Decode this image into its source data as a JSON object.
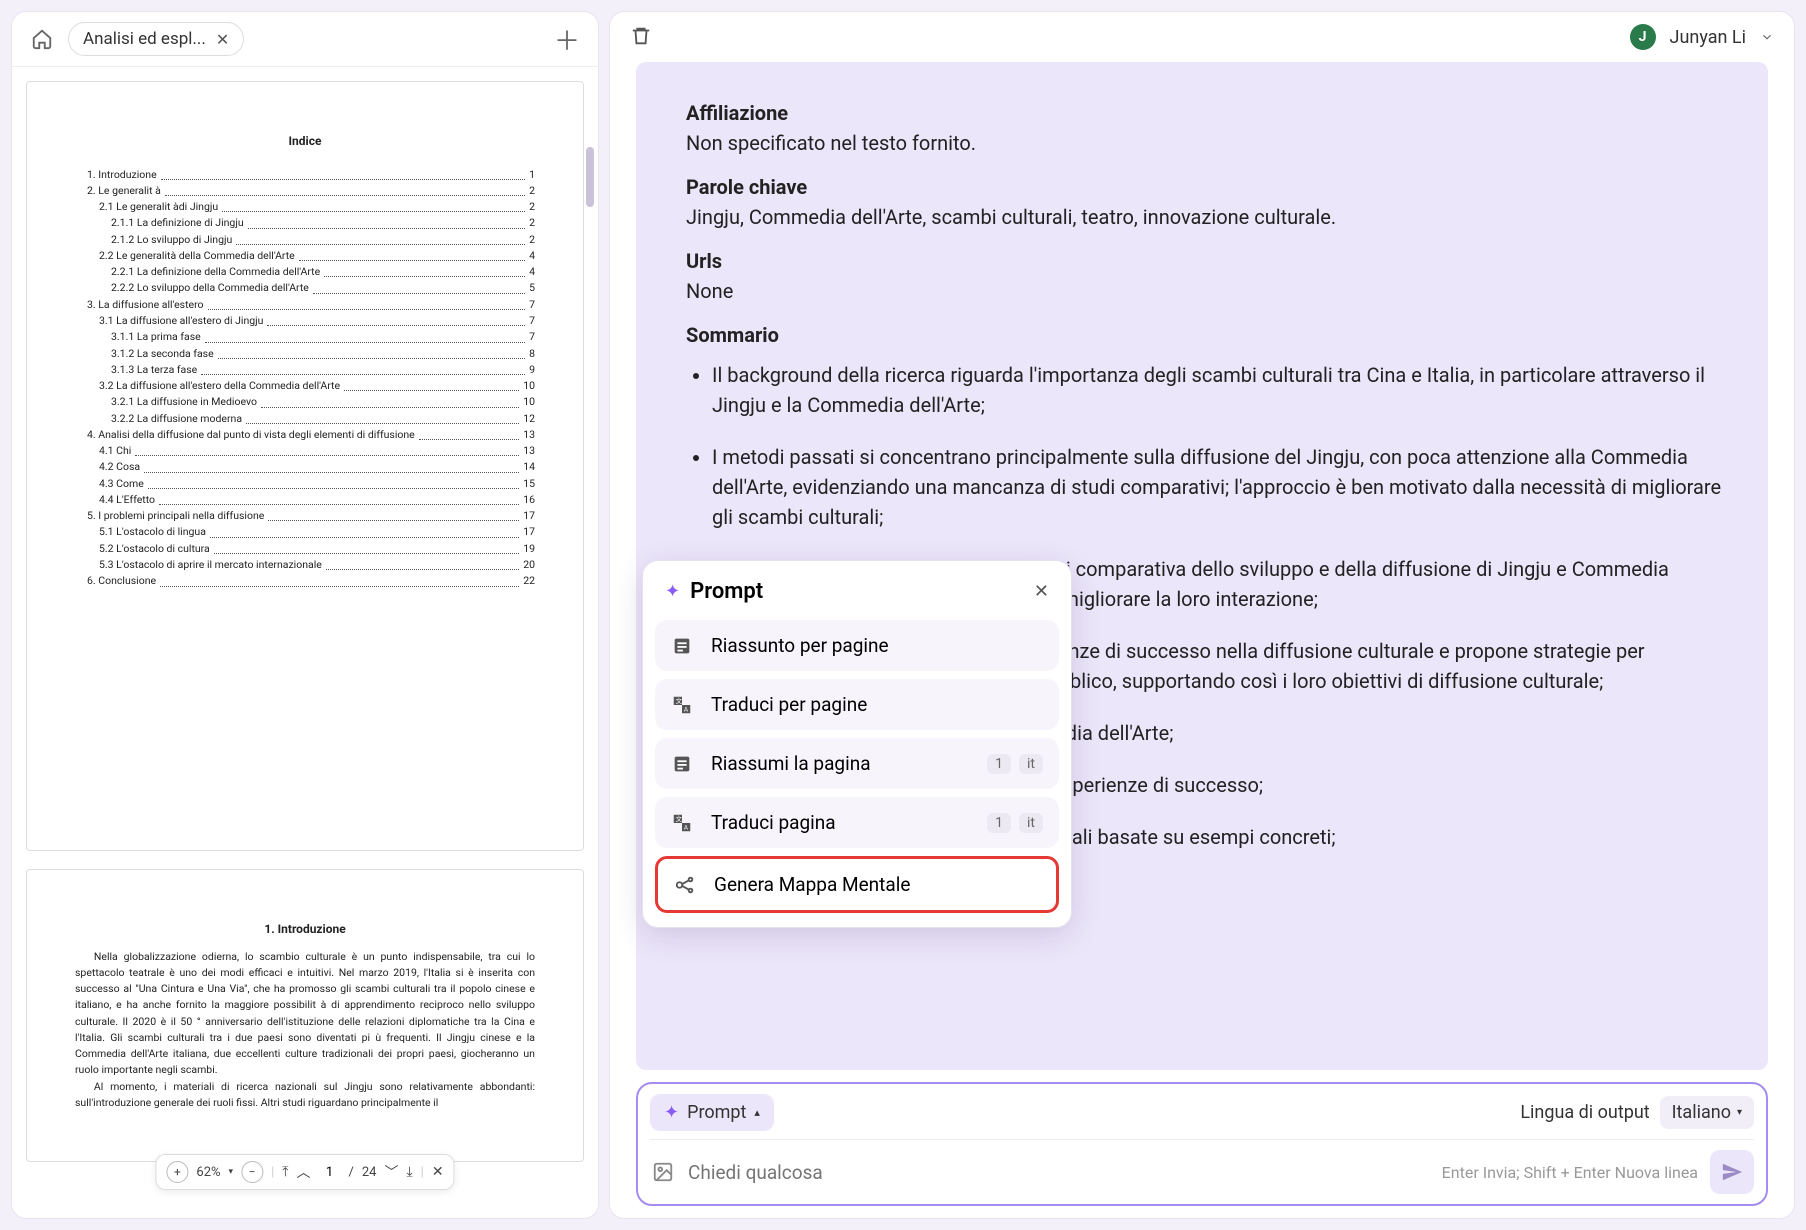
{
  "tab": {
    "label": "Analisi ed espl..."
  },
  "user": {
    "initial": "J",
    "name": "Junyan Li"
  },
  "doc": {
    "index_title": "Indice",
    "toc": [
      {
        "level": 1,
        "label": "1. Introduzione",
        "page": "1"
      },
      {
        "level": 1,
        "label": "2. Le generalit à",
        "page": "2"
      },
      {
        "level": 2,
        "label": "2.1 Le generalit àdi Jingju",
        "page": "2"
      },
      {
        "level": 3,
        "label": "2.1.1 La definizione di Jingju",
        "page": "2"
      },
      {
        "level": 3,
        "label": "2.1.2 Lo sviluppo di Jingju",
        "page": "2"
      },
      {
        "level": 2,
        "label": "2.2 Le generalità della Commedia dell'Arte",
        "page": "4"
      },
      {
        "level": 3,
        "label": "2.2.1 La definizione della Commedia dell'Arte",
        "page": "4"
      },
      {
        "level": 3,
        "label": "2.2.2 Lo sviluppo della Commedia dell'Arte",
        "page": "5"
      },
      {
        "level": 1,
        "label": "3. La diffusione all'estero",
        "page": "7"
      },
      {
        "level": 2,
        "label": "3.1 La diffusione all'estero di Jingju",
        "page": "7"
      },
      {
        "level": 3,
        "label": "3.1.1 La prima fase",
        "page": "7"
      },
      {
        "level": 3,
        "label": "3.1.2 La seconda fase",
        "page": "8"
      },
      {
        "level": 3,
        "label": "3.1.3 La terza fase",
        "page": "9"
      },
      {
        "level": 2,
        "label": "3.2 La diffusione all'estero della Commedia dell'Arte",
        "page": "10"
      },
      {
        "level": 3,
        "label": "3.2.1 La diffusione in Medioevo",
        "page": "10"
      },
      {
        "level": 3,
        "label": "3.2.2 La diffusione moderna",
        "page": "12"
      },
      {
        "level": 1,
        "label": "4. Analisi della diffusione dal punto di vista degli elementi di diffusione",
        "page": "13"
      },
      {
        "level": 2,
        "label": "4.1 Chi",
        "page": "13"
      },
      {
        "level": 2,
        "label": "4.2 Cosa",
        "page": "14"
      },
      {
        "level": 2,
        "label": "4.3 Come",
        "page": "15"
      },
      {
        "level": 2,
        "label": "4.4 L'Effetto",
        "page": "16"
      },
      {
        "level": 1,
        "label": "5. I problemi principali nella diffusione",
        "page": "17"
      },
      {
        "level": 2,
        "label": "5.1 L'ostacolo di lingua",
        "page": "17"
      },
      {
        "level": 2,
        "label": "5.2 L'ostacolo di cultura",
        "page": "19"
      },
      {
        "level": 2,
        "label": "5.3 L'ostacolo di aprire il mercato internazionale",
        "page": "20"
      },
      {
        "level": 1,
        "label": "6. Conclusione",
        "page": "22"
      }
    ],
    "intro_heading": "1. Introduzione",
    "intro_body": "Nella globalizzazione odierna, lo scambio culturale è un punto indispensabile, tra cui lo spettacolo teatrale è uno dei modi efficaci e intuitivi. Nel marzo 2019, l'Italia si è inserita con successo al \"Una Cintura e Una Via\", che ha promosso gli scambi culturali tra il popolo cinese e italiano, e ha anche fornito la maggiore possibilit à di apprendimento reciproco nello sviluppo culturale. Il 2020 è il 50 ° anniversario dell'istituzione delle relazioni diplomatiche tra la Cina e l'Italia. Gli scambi culturali tra i due paesi sono diventati pi ù frequenti. Il Jingju cinese e la Commedia dell'Arte italiana, due eccellenti culture tradizionali dei propri paesi, giocheranno un ruolo importante negli scambi.",
    "intro_body2": "Al momento, i materiali di ricerca nazionali sul Jingju sono relativamente abbondanti: sull'introduzione generale dei ruoli fissi. Altri studi riguardano principalmente il"
  },
  "pdf_toolbar": {
    "zoom": "62%",
    "page": "1",
    "total": "24"
  },
  "result": {
    "sections": [
      {
        "title": "Affiliazione",
        "value": "Non specificato nel testo fornito."
      },
      {
        "title": "Parole chiave",
        "value": "Jingju, Commedia dell'Arte, scambi culturali, teatro, innovazione culturale."
      },
      {
        "title": "Urls",
        "value": "None"
      }
    ],
    "summary_title": "Sommario",
    "bullets": [
      "Il background della ricerca riguarda l'importanza degli scambi culturali tra Cina e Italia, in particolare attraverso il Jingju e la Commedia dell'Arte;",
      "I metodi passati si concentrano principalmente sulla diffusione del Jingju, con poca attenzione alla Commedia dell'Arte, evidenziando una mancanza di studi comparativi; l'approccio è ben motivato dalla necessità di migliorare gli scambi culturali;",
      "Il metodo di ricerca consiste in un'analisi comparativa dello sviluppo e della diffusione di Jingju e Commedia dell'Arte, proponendo contromisure per migliorare la loro interazione;",
      "Il metodo analizza in dettaglio le esperienze di successo nella diffusione culturale e propone strategie per l'innovazione e la partecipazione del pubblico, supportando così i loro obiettivi di diffusione culturale;",
      "Analisi comparativa tra Jingju e Commedia dell'Arte;",
      "Identificazione della diffusione e delle esperienze di successo;",
      "Proposte per migliorare gli scambi culturali basate su esempi concreti;"
    ]
  },
  "popover": {
    "title": "Prompt",
    "items": [
      {
        "icon": "summary",
        "label": "Riassunto per pagine"
      },
      {
        "icon": "translate",
        "label": "Traduci per pagine"
      },
      {
        "icon": "summary",
        "label": "Riassumi la pagina",
        "badges": [
          "1",
          "it"
        ]
      },
      {
        "icon": "translate",
        "label": "Traduci pagina",
        "badges": [
          "1",
          "it"
        ]
      },
      {
        "icon": "mindmap",
        "label": "Genera Mappa Mentale",
        "highlighted": true
      }
    ]
  },
  "chat": {
    "prompt_chip": "Prompt",
    "output_lang_label": "Lingua di output",
    "output_lang_value": "Italiano",
    "placeholder": "Chiedi qualcosa",
    "hint": "Enter Invia; Shift + Enter Nuova linea"
  }
}
